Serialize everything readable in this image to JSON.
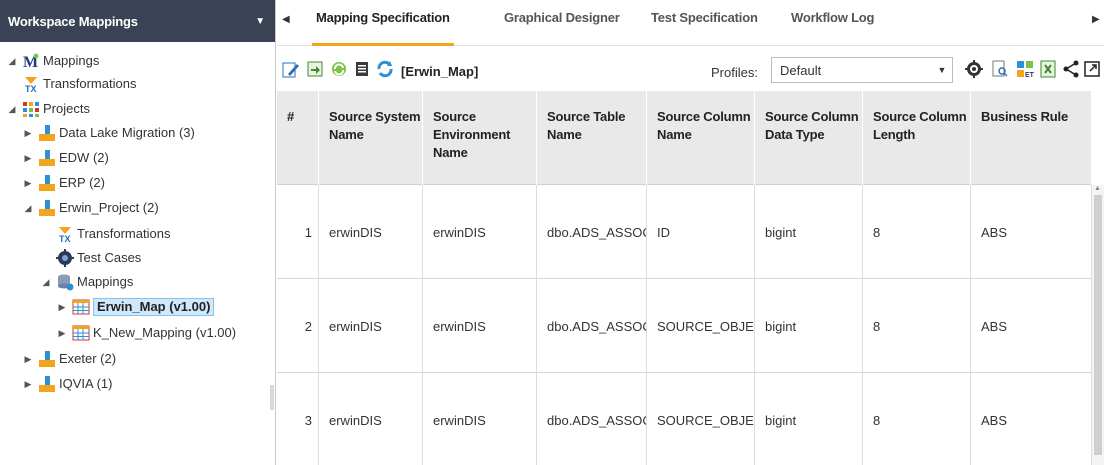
{
  "left_panel": {
    "title": "Workspace Mappings",
    "tree": [
      {
        "label": "Mappings",
        "icon": "mappings-m-icon"
      },
      {
        "label": "Transformations",
        "icon": "transformations-icon"
      },
      {
        "label": "Projects",
        "icon": "projects-icon"
      },
      {
        "label": "Data Lake Migration (3)",
        "icon": "project-icon"
      },
      {
        "label": "EDW (2)",
        "icon": "project-icon"
      },
      {
        "label": "ERP (2)",
        "icon": "project-icon"
      },
      {
        "label": "Erwin_Project (2)",
        "icon": "project-icon"
      },
      {
        "label": "Transformations",
        "icon": "transformations-icon"
      },
      {
        "label": "Test Cases",
        "icon": "test-cases-icon"
      },
      {
        "label": "Mappings",
        "icon": "mappings-folder-icon"
      },
      {
        "label": "Erwin_Map (v1.00)",
        "icon": "mapping-table-icon"
      },
      {
        "label": "K_New_Mapping (v1.00)",
        "icon": "mapping-table-icon"
      },
      {
        "label": "Exeter (2)",
        "icon": "project-icon"
      },
      {
        "label": "IQVIA (1)",
        "icon": "project-icon"
      }
    ]
  },
  "tabs": [
    "Mapping Specification",
    "Graphical Designer",
    "Test Specification",
    "Workflow Log"
  ],
  "toolbar": {
    "map_label": "[Erwin_Map]",
    "profiles_label": "Profiles:",
    "profile_value": "Default"
  },
  "grid": {
    "columns": [
      "#",
      "Source System Name",
      "Source Environment Name",
      "Source Table Name",
      "Source Column Name",
      "Source Column Data Type",
      "Source Column Length",
      "Business Rule"
    ],
    "rows": [
      [
        "1",
        "erwinDIS",
        "erwinDIS",
        "dbo.ADS_ASSOCI/",
        "ID",
        "bigint",
        "8",
        "ABS"
      ],
      [
        "2",
        "erwinDIS",
        "erwinDIS",
        "dbo.ADS_ASSOCI/",
        "SOURCE_OBJECT_",
        "bigint",
        "8",
        "ABS"
      ],
      [
        "3",
        "erwinDIS",
        "erwinDIS",
        "dbo.ADS_ASSOCI/",
        "SOURCE_OBJECT_",
        "bigint",
        "8",
        "ABS"
      ]
    ]
  },
  "colors": {
    "header_bg": "#3a4355",
    "tab_accent": "#f3a41b",
    "selection_bg": "#cfe8fc",
    "grid_header_bg": "#e9e9e9"
  }
}
